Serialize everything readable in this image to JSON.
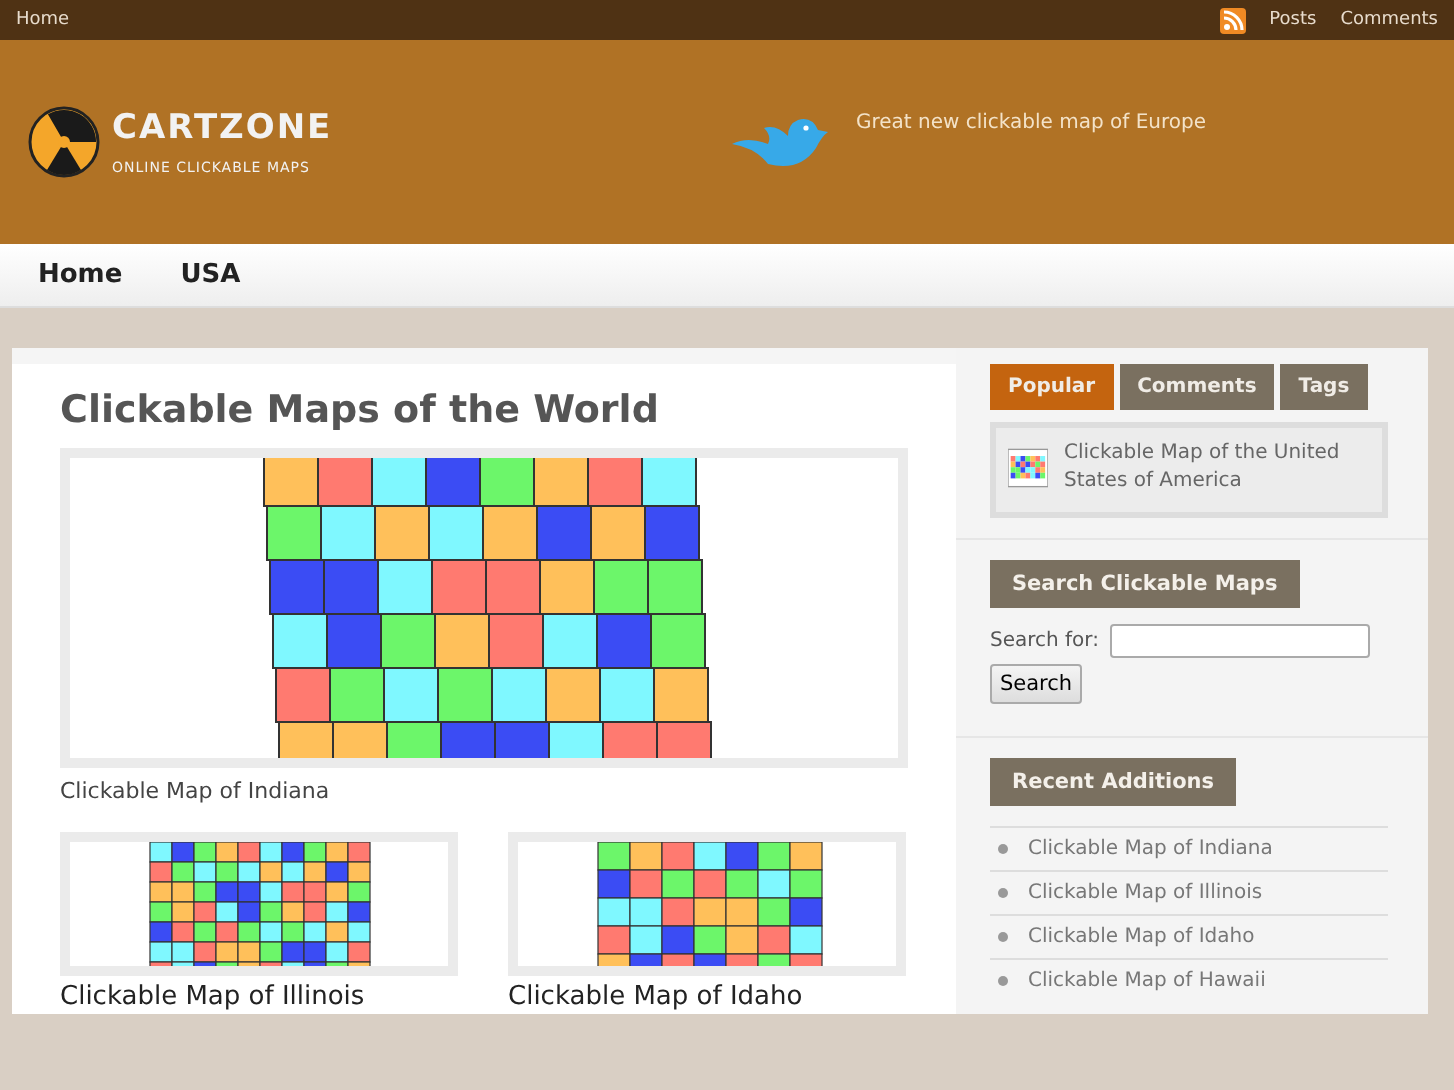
{
  "top_bar": {
    "links": [
      "Home"
    ],
    "feed_links": [
      "Posts",
      "Comments"
    ]
  },
  "header": {
    "logo_title": "CARTZONE",
    "logo_tagline": "ONLINE CLICKABLE MAPS",
    "tweet": "Great new clickable map of Europe"
  },
  "nav": {
    "items": [
      "Home",
      "USA"
    ]
  },
  "main": {
    "title": "Clickable Maps of the World",
    "featured_caption": "Clickable Map of Indiana",
    "posts": [
      {
        "title": "Clickable Map of Illinois"
      },
      {
        "title": "Clickable Map of Idaho"
      }
    ]
  },
  "sidebar": {
    "tabs": [
      {
        "label": "Popular",
        "selected": true
      },
      {
        "label": "Comments",
        "selected": false
      },
      {
        "label": "Tags",
        "selected": false
      }
    ],
    "popular": [
      {
        "title": "Clickable Map of the United States of America"
      }
    ],
    "search": {
      "heading": "Search Clickable Maps",
      "label": "Search for:",
      "button": "Search"
    },
    "recent": {
      "heading": "Recent Additions",
      "items": [
        "Clickable Map of Indiana",
        "Clickable Map of Illinois",
        "Clickable Map of Idaho",
        "Clickable Map of Hawaii"
      ]
    }
  }
}
